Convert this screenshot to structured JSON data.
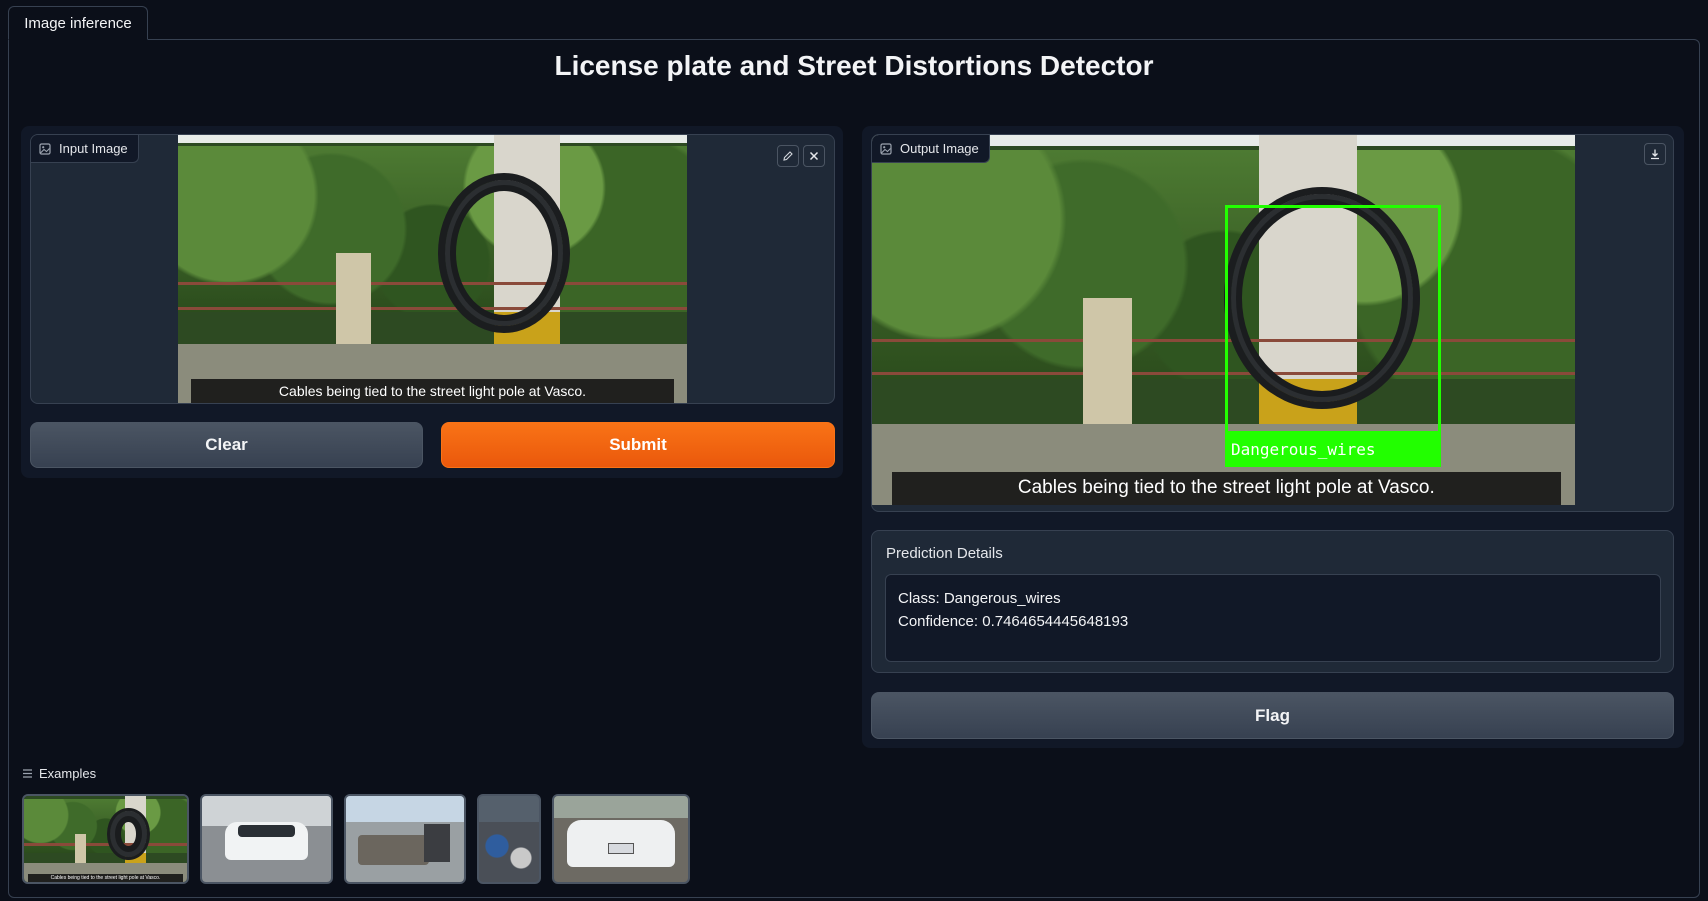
{
  "tabs": [
    {
      "label": "Image inference"
    }
  ],
  "page": {
    "title": "License plate and Street Distortions Detector"
  },
  "input": {
    "label": "Input Image",
    "caption": "Cables being tied to the street light pole at Vasco.",
    "edit_icon": "pencil-icon",
    "clear_icon": "close-icon"
  },
  "output": {
    "label": "Output Image",
    "caption": "Cables being tied to the street light pole at Vasco.",
    "detection_label": "Dangerous_wires",
    "download_icon": "download-icon",
    "box_color": "#22ff00"
  },
  "buttons": {
    "clear": "Clear",
    "submit": "Submit",
    "flag": "Flag"
  },
  "prediction": {
    "title": "Prediction Details",
    "class_line": "Class: Dangerous_wires",
    "confidence_line": "Confidence: 0.7464654445648193"
  },
  "examples": {
    "label": "Examples",
    "thumbnail_caption": "Cables being tied to the street light pole at Vasco."
  },
  "colors": {
    "accent": "#f97316",
    "background": "#0b0f19",
    "panel": "#111827"
  }
}
